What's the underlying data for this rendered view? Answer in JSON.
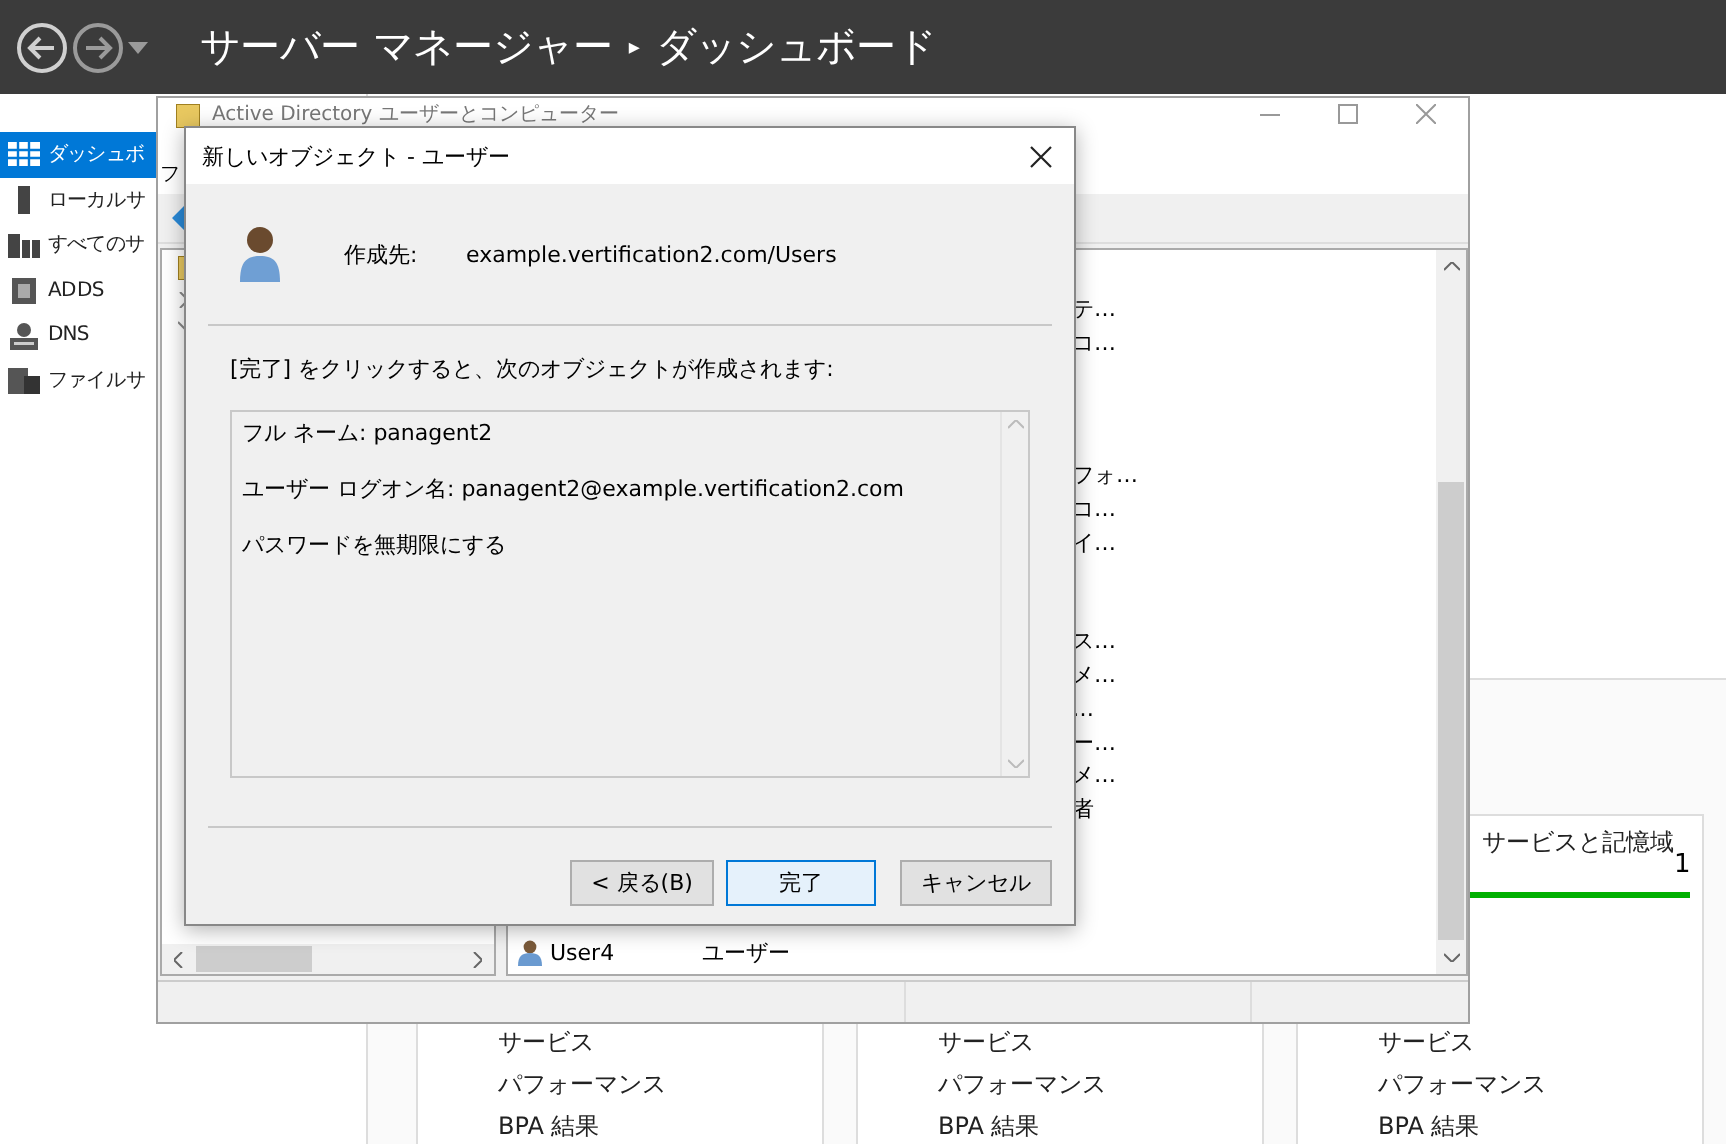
{
  "app_bar": {
    "title": "サーバー マネージャー",
    "separator": "▸",
    "page": "ダッシュボード"
  },
  "sidebar": {
    "items": [
      {
        "label": "ダッシュボ",
        "kind": "dashboard",
        "selected": true
      },
      {
        "label": "ローカル サ",
        "kind": "server",
        "selected": false
      },
      {
        "label": "すべてのサ",
        "kind": "servers",
        "selected": false
      },
      {
        "label": "AD DS",
        "kind": "adds",
        "selected": false
      },
      {
        "label": "DNS",
        "kind": "dns",
        "selected": false
      },
      {
        "label": "ファイル サ",
        "kind": "file",
        "selected": false
      }
    ]
  },
  "dashboard": {
    "tiles": [
      {
        "links": [
          "サービス",
          "パフォーマンス",
          "BPA 結果"
        ]
      },
      {
        "links": [
          "サービス",
          "パフォーマンス",
          "BPA 結果"
        ]
      },
      {
        "title": "サービスと記憶域",
        "count": "1",
        "links": [
          "サービス",
          "パフォーマンス",
          "BPA 結果"
        ]
      }
    ]
  },
  "aduc_window": {
    "title": "Active Directory ユーザーとコンピューター",
    "menu": [
      "フ"
    ],
    "cut_texts": [
      [
        "テ…",
        "コ…"
      ],
      [
        "フォ…",
        "コ…",
        "イ…"
      ],
      [
        "ス…",
        "メ…",
        "…",
        "ー…",
        "メ…",
        "者"
      ]
    ],
    "rows": [
      {
        "name": "User4",
        "type": "ユーザー"
      }
    ]
  },
  "dialog": {
    "title": "新しいオブジェクト - ユーザー",
    "create_in_label": "作成先:",
    "create_in_path": "example.vertification2.com/Users",
    "instruction": "[完了] をクリックすると、次のオブジェクトが作成されます:",
    "summary_lines": [
      "フル ネーム: panagent2",
      "ユーザー ログオン名: panagent2@example.vertification2.com",
      "パスワードを無期限にする"
    ],
    "buttons": [
      {
        "label": "< 戻る(B)",
        "default": false
      },
      {
        "label": "完了",
        "default": true
      },
      {
        "label": "キャンセル",
        "default": false
      }
    ]
  }
}
